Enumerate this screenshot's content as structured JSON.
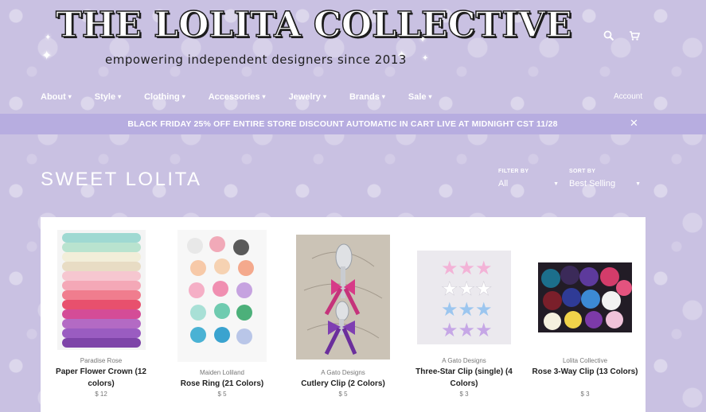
{
  "brand": {
    "title": "THE LOLITA COLLECTIVE",
    "tagline": "empowering independent designers since 2013"
  },
  "header": {
    "search_icon": "search-icon",
    "cart_icon": "cart-icon"
  },
  "nav": {
    "items": [
      {
        "label": "About"
      },
      {
        "label": "Style"
      },
      {
        "label": "Clothing"
      },
      {
        "label": "Accessories"
      },
      {
        "label": "Jewelry"
      },
      {
        "label": "Brands"
      },
      {
        "label": "Sale"
      }
    ],
    "account_label": "Account"
  },
  "announcement": {
    "text": "BLACK FRIDAY 25% OFF ENTIRE STORE DISCOUNT AUTOMATIC IN CART LIVE AT MIDNIGHT CST 11/28",
    "close_label": "Close"
  },
  "collection": {
    "title": "SWEET LOLITA",
    "filter_label": "FILTER BY",
    "filter_value": "All",
    "sort_label": "SORT BY",
    "sort_value": "Best Selling"
  },
  "products": [
    {
      "vendor": "Paradise Rose",
      "name": "Paper Flower Crown (12 colors)",
      "price": "$ 12"
    },
    {
      "vendor": "Maiden Loliland",
      "name": "Rose Ring (21 Colors)",
      "price": "$ 5"
    },
    {
      "vendor": "A Gato Designs",
      "name": "Cutlery Clip (2 Colors)",
      "price": "$ 5"
    },
    {
      "vendor": "A Gato Designs",
      "name": "Three-Star Clip (single) (4 Colors)",
      "price": "$ 3"
    },
    {
      "vendor": "Lolita Collective",
      "name": "Rose 3-Way Clip (13 Colors)",
      "price": "$ 3"
    }
  ],
  "colors": {
    "background": "#c9c1e2",
    "announcement_bar": "#b7ade0",
    "text_white": "#ffffff"
  }
}
